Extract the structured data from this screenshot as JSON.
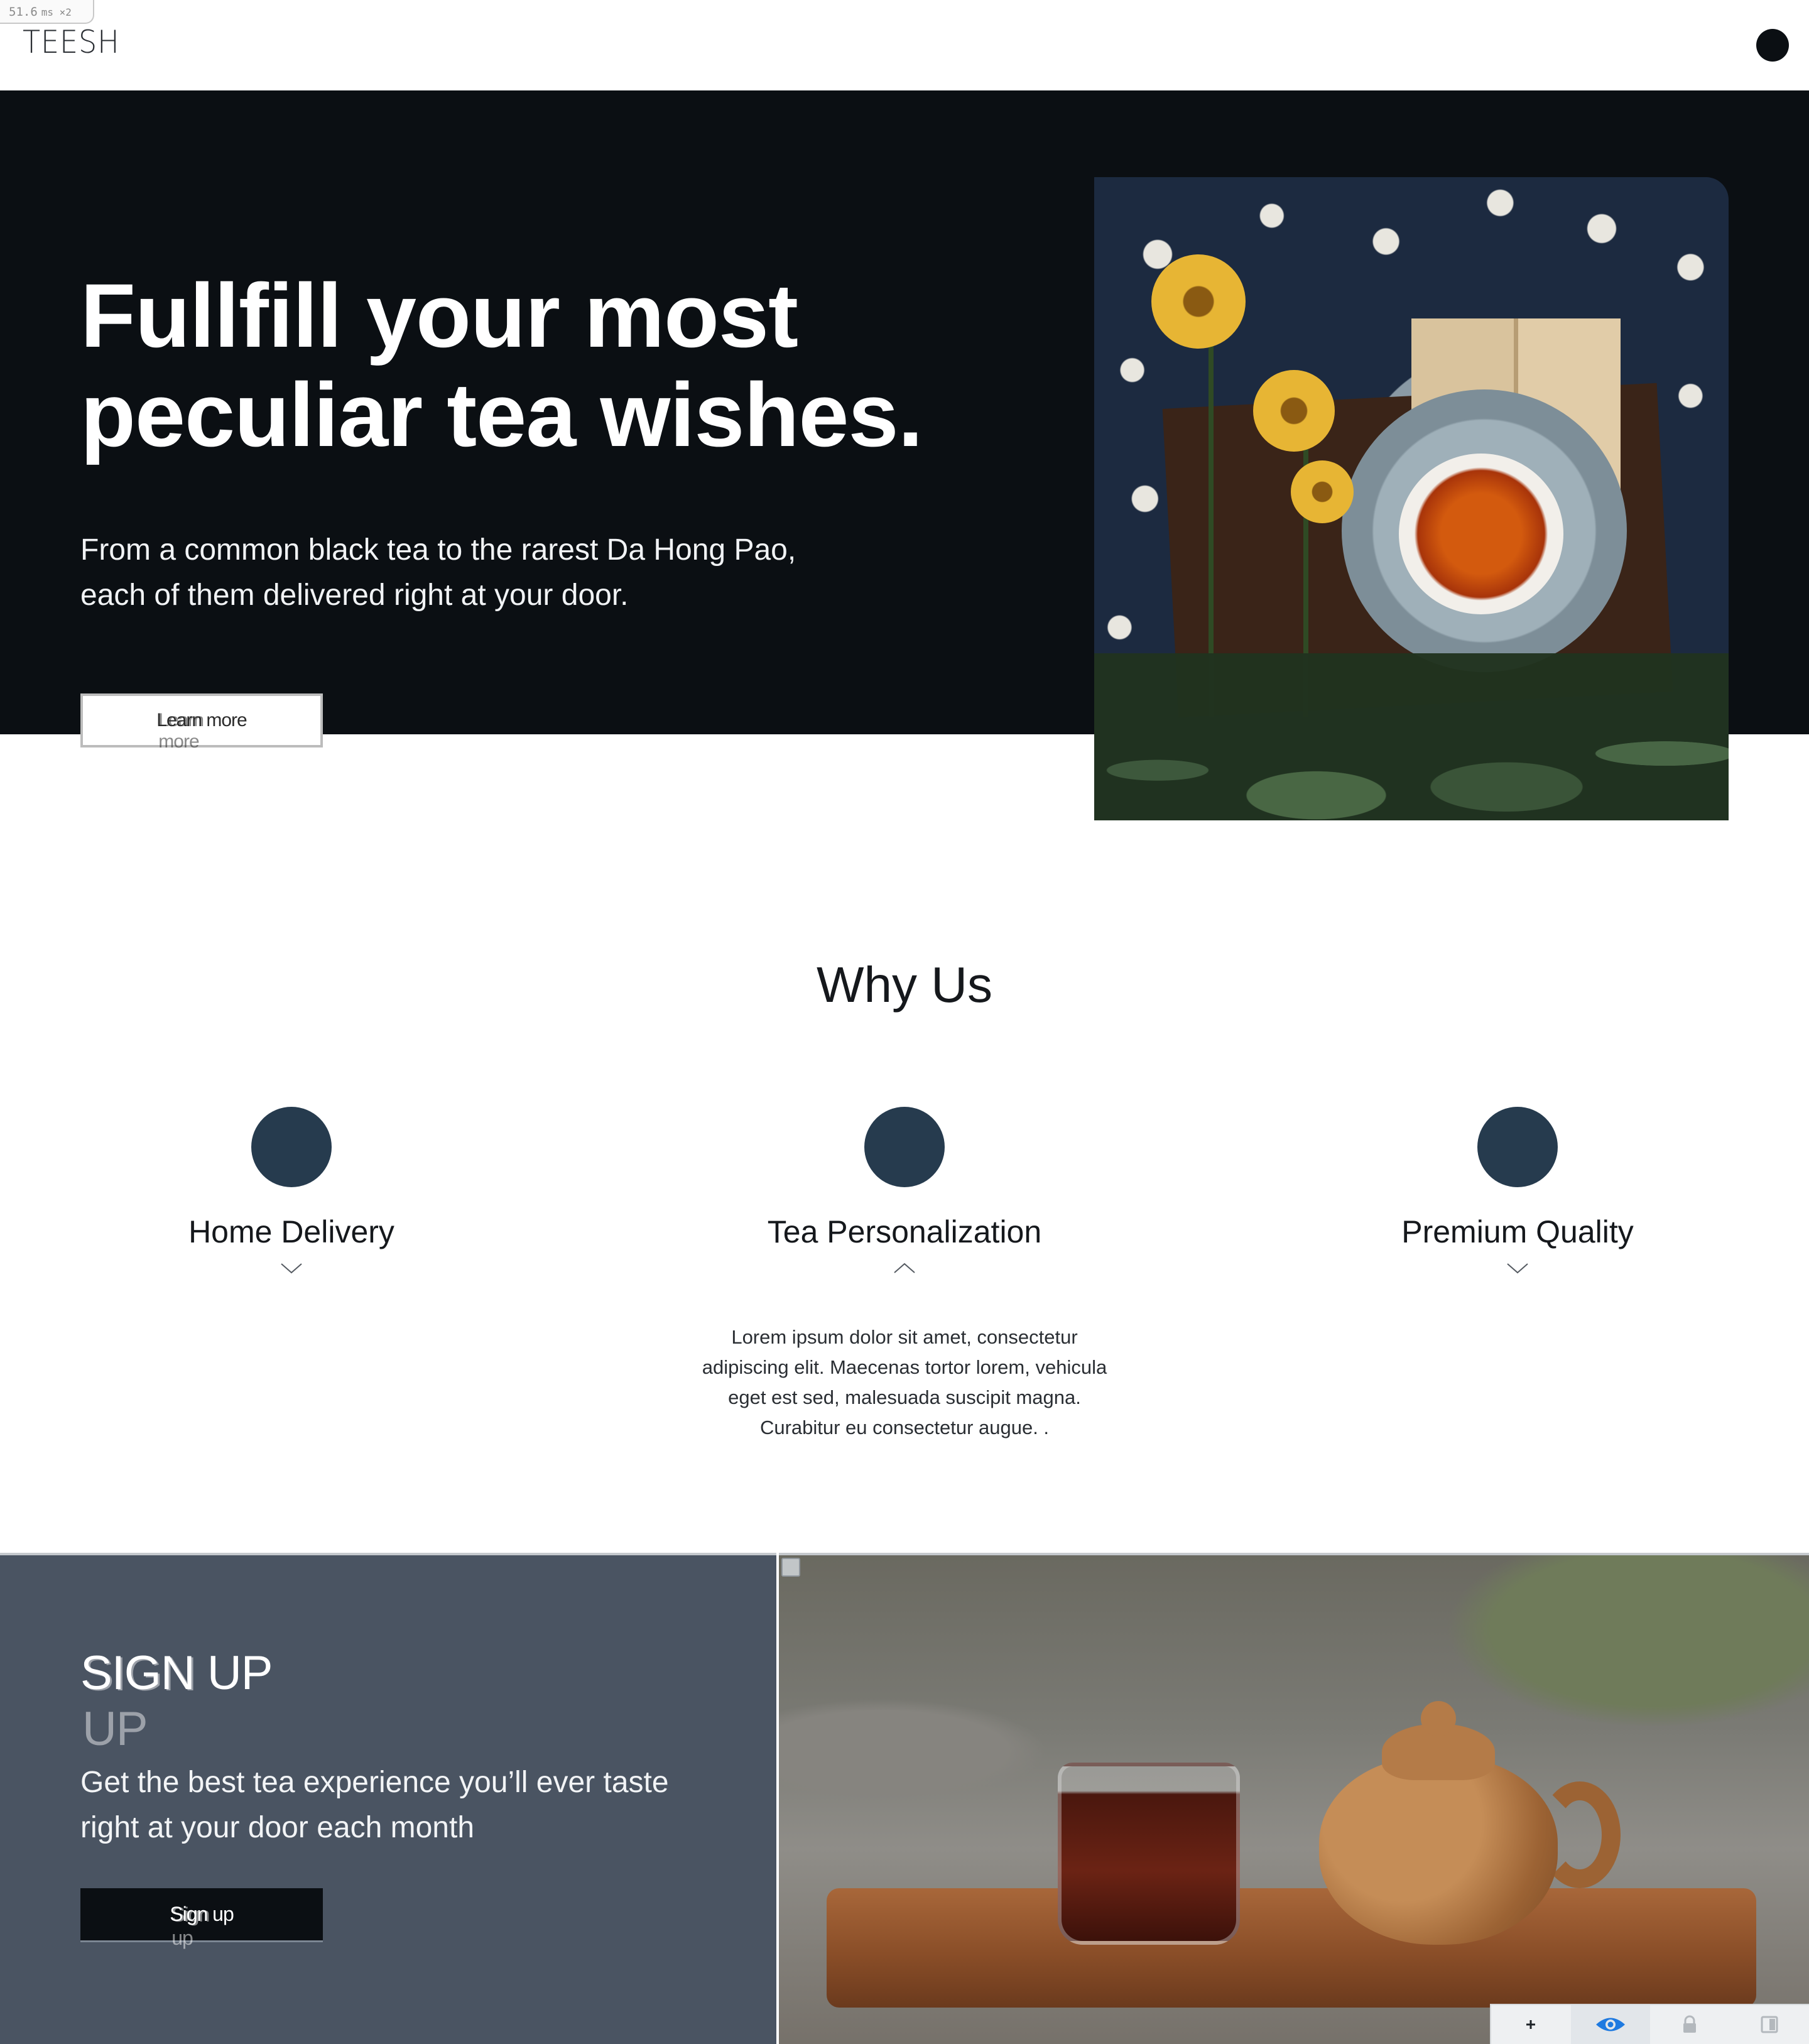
{
  "perf": {
    "value": "51.6",
    "unit": "ms ×2"
  },
  "header": {
    "logo": "TEESH",
    "menu_icon": "circle-menu-icon"
  },
  "hero": {
    "title": "Fullfill your most peculiar tea wishes.",
    "subtitle": "From a common black tea to the rarest Da Hong Pao, each of them delivered right at your door.",
    "button_label": "Learn more"
  },
  "why_us": {
    "title": "Why Us",
    "features": [
      {
        "label": "Home Delivery",
        "chevron": "chevron-down-icon",
        "expanded": false,
        "description": ""
      },
      {
        "label": "Tea Personalization",
        "chevron": "chevron-up-icon",
        "expanded": true,
        "description": "Lorem ipsum dolor sit amet, consectetur adipiscing elit. Maecenas tortor lorem, vehicula eget est sed, malesuada suscipit magna. Curabitur eu consectetur augue. ."
      },
      {
        "label": "Premium Quality",
        "chevron": "chevron-down-icon",
        "expanded": false,
        "description": ""
      }
    ]
  },
  "signup": {
    "title": "SIGN UP",
    "text": "Get the best tea experience you’ll ever taste right at your door each month",
    "button_label": "Sign up"
  },
  "toolbar": {
    "items": [
      "plus-icon",
      "eye-icon",
      "lock-icon",
      "panel-icon"
    ],
    "active": "eye-icon"
  },
  "colors": {
    "dark": "#0b0f13",
    "accent_circle": "#263b4e",
    "signup_bg": "#4a5462",
    "toolbar_eye": "#1f7ae0"
  }
}
